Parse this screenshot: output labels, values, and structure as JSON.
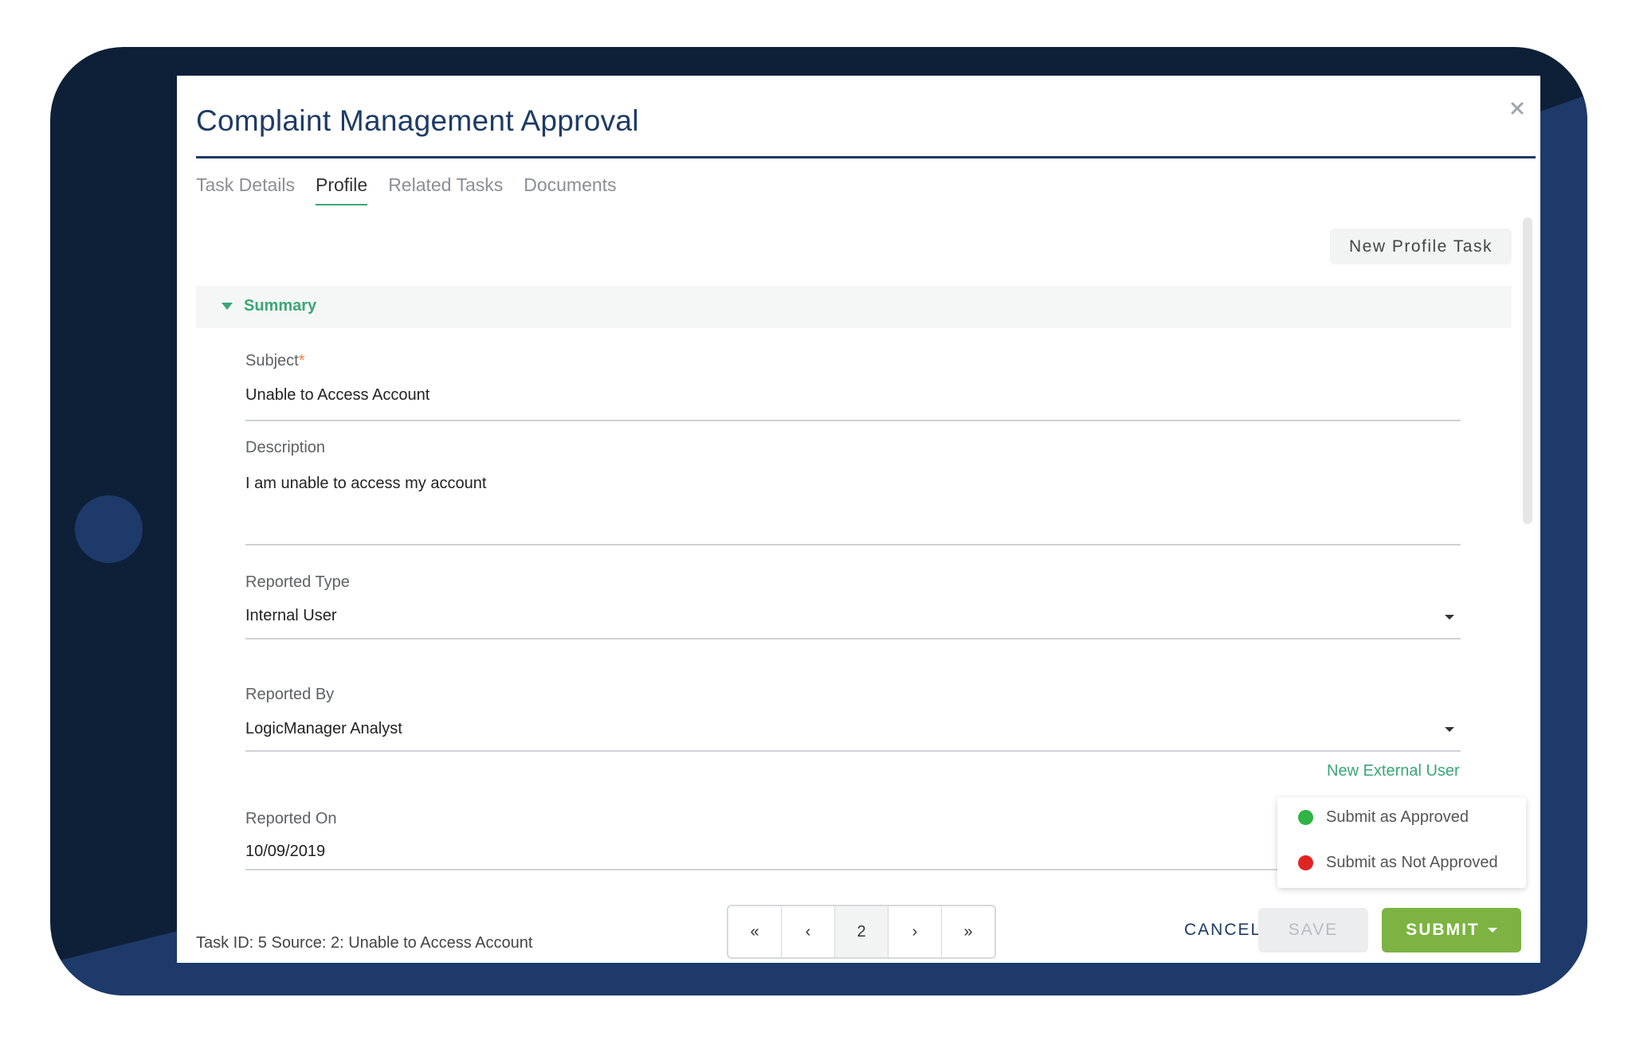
{
  "dialog": {
    "title": "Complaint Management Approval",
    "new_profile_task": "New Profile Task"
  },
  "tabs": [
    {
      "label": "Task Details",
      "active": false
    },
    {
      "label": "Profile",
      "active": true
    },
    {
      "label": "Related Tasks",
      "active": false
    },
    {
      "label": "Documents",
      "active": false
    }
  ],
  "summary": {
    "label": "Summary"
  },
  "fields": {
    "subject": {
      "label": "Subject",
      "required_mark": "*",
      "value": "Unable to Access Account"
    },
    "description": {
      "label": "Description",
      "value": "I am unable to access my account"
    },
    "reported_type": {
      "label": "Reported Type",
      "value": "Internal User"
    },
    "reported_by": {
      "label": "Reported By",
      "value": "LogicManager Analyst"
    },
    "reported_on": {
      "label": "Reported On",
      "value": "10/09/2019"
    }
  },
  "new_external_user": "New External User",
  "submit_menu": [
    {
      "label": "Submit as Approved",
      "color": "#2fb344"
    },
    {
      "label": "Submit as Not Approved",
      "color": "#e02424"
    }
  ],
  "footer": {
    "task_info": "Task ID: 5  Source: 2: Unable to Access Account",
    "pager": {
      "first": "«",
      "prev": "‹",
      "current": "2",
      "next": "›",
      "last": "»"
    },
    "cancel": "CANCEL",
    "save": "SAVE",
    "submit": "SUBMIT"
  },
  "colors": {
    "accent_green": "#3aa776",
    "submit_green": "#7cb342",
    "navy": "#1d3b66"
  }
}
